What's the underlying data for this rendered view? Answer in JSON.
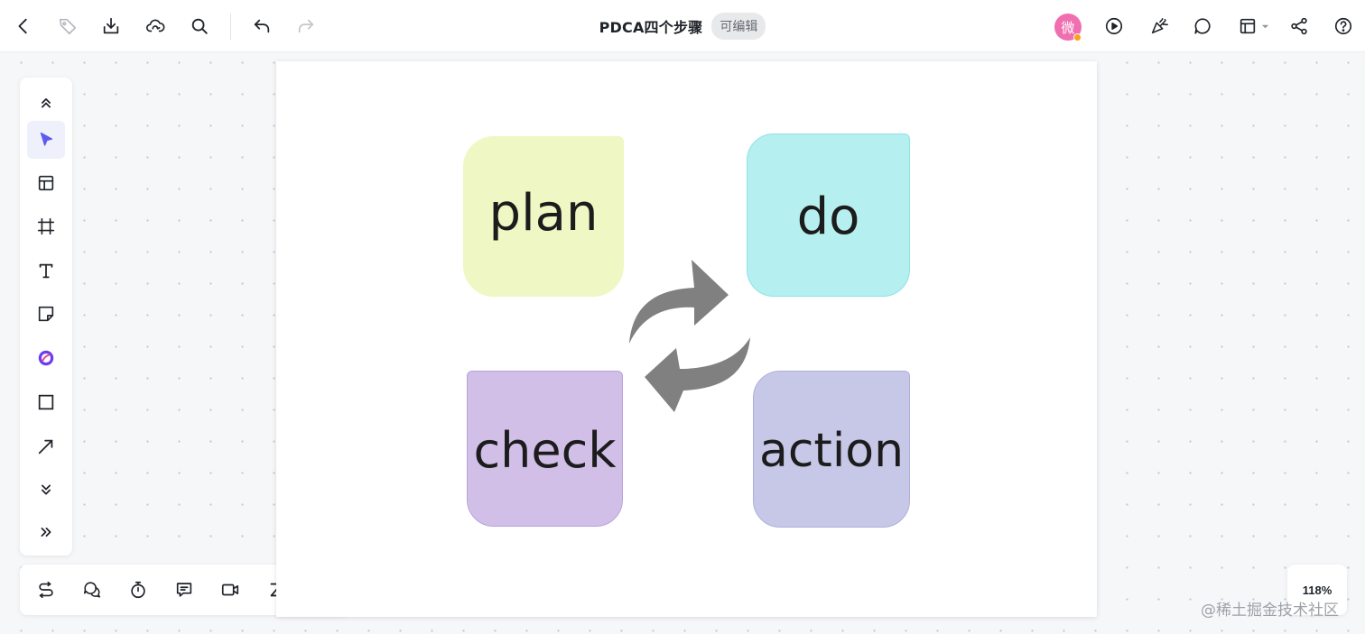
{
  "topbar": {
    "title": "PDCA四个步骤",
    "badge": "可编辑",
    "avatar_char": "微",
    "left_tools": [
      "back-icon",
      "tag-icon",
      "download-icon",
      "cloud-sync-icon",
      "search-icon",
      "undo-icon",
      "redo-icon"
    ],
    "right_tools": [
      "present-icon",
      "celebrate-icon",
      "comment-icon",
      "layout-icon",
      "share-icon",
      "help-icon"
    ]
  },
  "left_toolbar": {
    "items": [
      "collapse-up-icon",
      "select-cursor-icon",
      "template-icon",
      "frame-icon",
      "text-icon",
      "sticky-note-icon",
      "pen-icon",
      "rectangle-icon",
      "connector-arrow-icon",
      "more-down-icon",
      "expand-icon"
    ],
    "active": "select-cursor-icon"
  },
  "bottom_toolbar": {
    "items": [
      "flow-icon",
      "chat-bubbles-icon",
      "timer-icon",
      "comment-box-icon",
      "video-icon",
      "zzz-icon",
      "history-icon"
    ]
  },
  "canvas": {
    "cards": {
      "plan": "plan",
      "do": "do",
      "check": "check",
      "action": "action"
    },
    "colors": {
      "plan": "#eff7c4",
      "do": "#b5eff0",
      "check": "#d1bfe8",
      "action": "#c7c8e7",
      "arrows": "#808080"
    }
  },
  "zoom": {
    "level": "118%"
  },
  "watermark": "@稀土掘金技术社区"
}
